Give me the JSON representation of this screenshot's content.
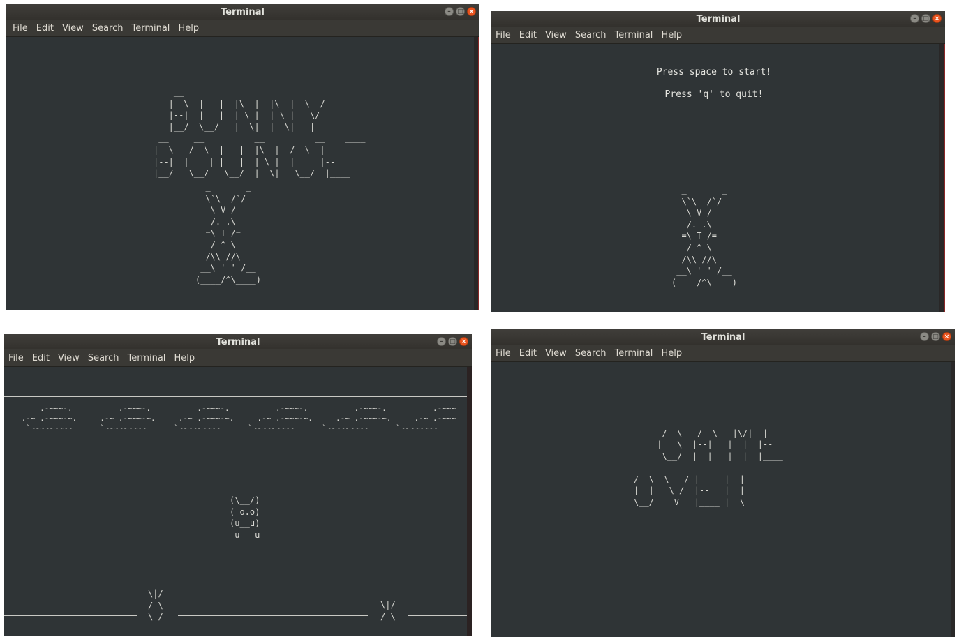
{
  "menu": [
    "File",
    "Edit",
    "View",
    "Search",
    "Terminal",
    "Help"
  ],
  "windows": {
    "title_screen": {
      "title": "Terminal",
      "art_title": "    __\n   |  \\  |   |  |\\  |  |\\  |  \\  /\n   |--|  |   |  | \\ |  | \\ |   \\/\n   |__/  \\__/   |  \\|  |  \\|   |\n __     __          __          __    ____\n|  \\   /  \\  |   |  |\\  |  /  \\  |\n|--|  |    | |   |  | \\ |  |     |--\n|__/   \\__/   \\__/  |  \\|   \\__/  |____",
      "art_bunny": "  _       _\n  \\`\\  /`/\n   \\ V /\n   /. .\\\n  =\\ T /=\n   / ^ \\\n  /\\\\ //\\\n __\\ ' ' /__\n(____/^\\____)"
    },
    "start_screen": {
      "title": "Terminal",
      "line1": "Press space to start!",
      "line2": "Press 'q' to quit!",
      "art_bunny": "  _       _\n  \\`\\  /`/\n   \\ V /\n   /. .\\\n  =\\ T /=\n   / ^ \\\n  /\\\\ //\\\n __\\ ' ' /__\n(____/^\\____)"
    },
    "game_screen": {
      "title": "Terminal",
      "art_clouds": "     .-~~~-.          .-~~~-.          .-~~~-.          .-~~~-.          .-~~~-.          .-~~~\n .-~ .-~~~-~.     .-~ .-~~~-~.     .-~ .-~~~-~.     .-~ .-~~~-~.     .-~ .-~~~-~.     .-~ .-~~~\n  `~-~~-~~~~      `~-~~-~~~~      `~-~~-~~~~      `~-~~-~~~~      `~-~~-~~~~      `~-~~~~~~",
      "art_bunny": "(\\__/)\n( o.o)\n(u__u)\n u   u",
      "art_spike1": "\\|/\n/ \\\n\\ /",
      "art_spike2": "\\|/\n/ \\"
    },
    "over_screen": {
      "title": "Terminal",
      "art_game": "   __     __           ____\n  /  \\   /  \\   |\\/|  |\n |   \\  |--|   |  |  |--\n  \\__/  |  |   |  |  |____",
      "art_over": " __         ____   __\n/  \\  \\   / |     |  |\n|  |   \\ /  |--   |__|\n\\__/    V   |____ |  \\"
    }
  }
}
